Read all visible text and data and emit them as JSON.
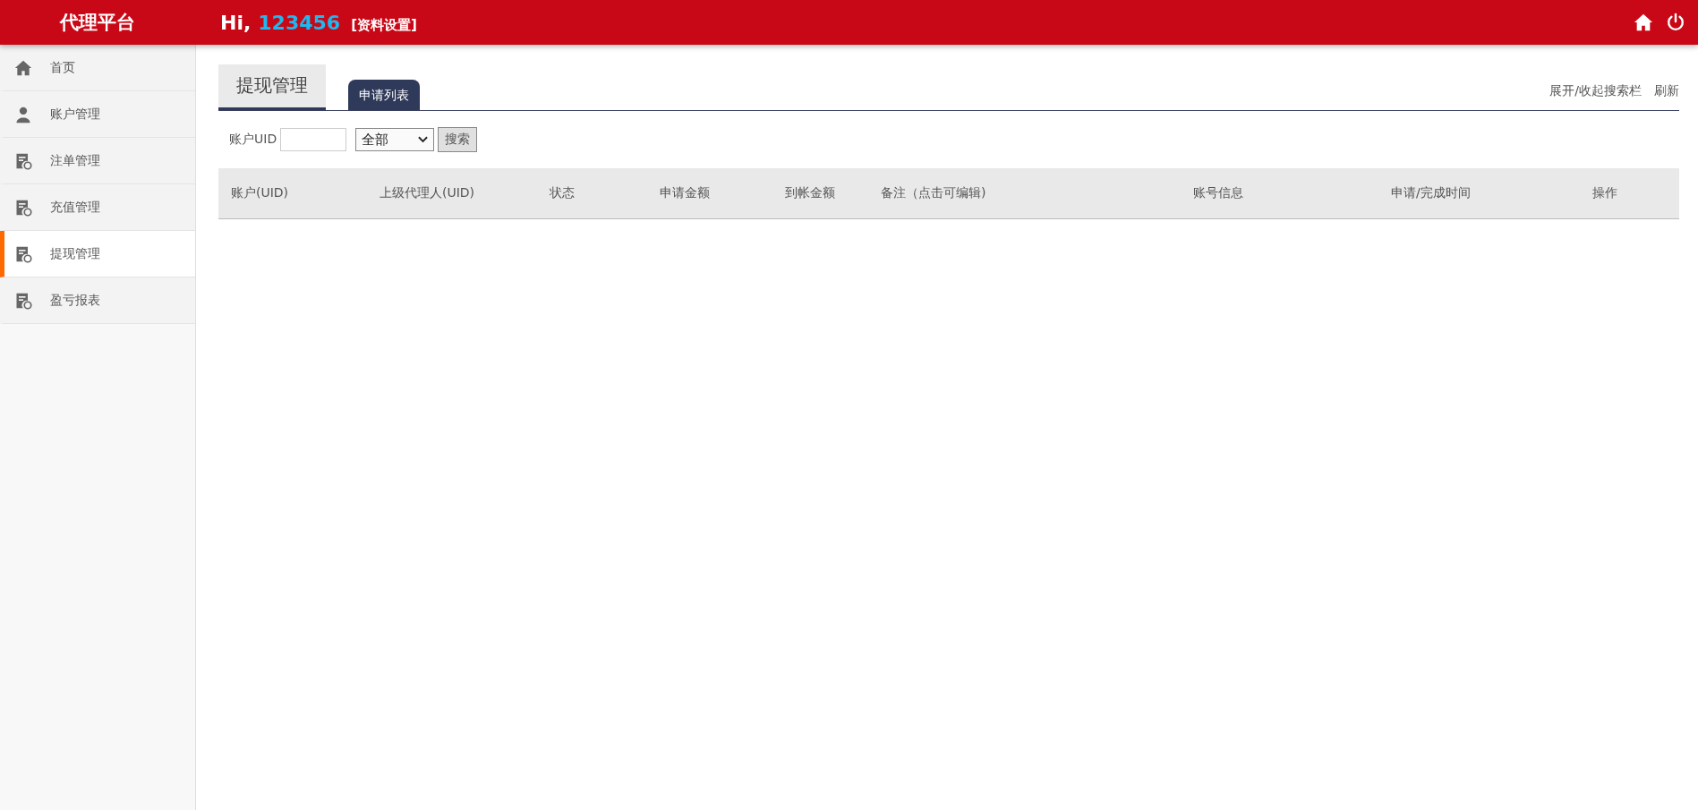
{
  "header": {
    "brand": "代理平台",
    "greeting": "Hi,",
    "user": "123456",
    "profile_link": "[资料设置]"
  },
  "sidebar": {
    "items": [
      {
        "label": "首页",
        "kind": "home",
        "selected": false
      },
      {
        "label": "账户管理",
        "kind": "user",
        "selected": false
      },
      {
        "label": "注单管理",
        "kind": "doc",
        "selected": false
      },
      {
        "label": "充值管理",
        "kind": "doc",
        "selected": false
      },
      {
        "label": "提现管理",
        "kind": "doc",
        "selected": true
      },
      {
        "label": "盈亏报表",
        "kind": "doc",
        "selected": false
      }
    ]
  },
  "page": {
    "title": "提现管理",
    "tabs": [
      {
        "label": "申请列表",
        "selected": true
      }
    ],
    "actions": [
      "展开/收起搜索栏",
      "刷新"
    ]
  },
  "search": {
    "uid_label": "账户UID",
    "status_select": "全部",
    "button": "搜索"
  },
  "table": {
    "columns": [
      "账户(UID)",
      "上级代理人(UID)",
      "状态",
      "申请金额",
      "到帐金额",
      "备注（点击可编辑)",
      "账号信息",
      "申请/完成时间",
      "操作"
    ]
  }
}
